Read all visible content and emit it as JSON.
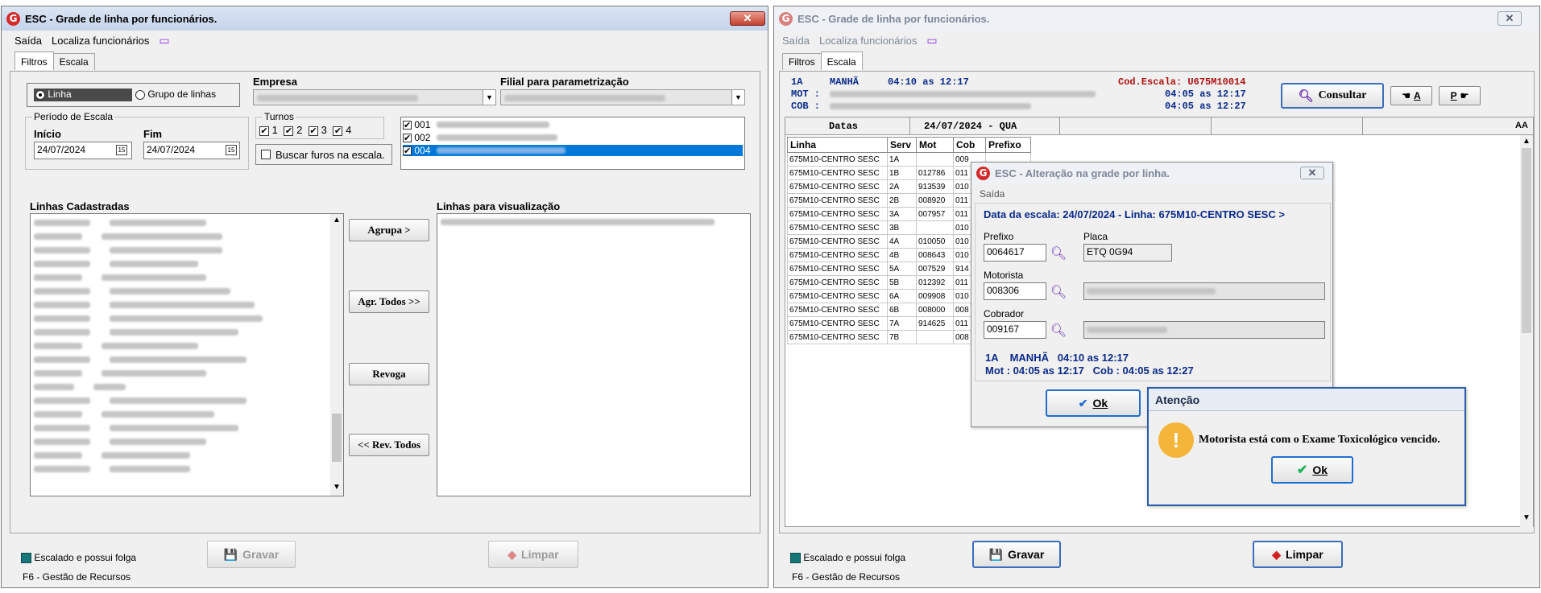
{
  "colors": {
    "title_active": "#c5d4ea",
    "close_red": "#c2402c",
    "accent_blue": "#0a2a8a",
    "status_red": "#b01010",
    "teal": "#17767a",
    "selection": "#0078d7"
  },
  "left": {
    "title": "ESC - Grade de linha por funcionários.",
    "close": "✕",
    "menu": {
      "saida": "Saída",
      "localiza": "Localiza funcionários"
    },
    "tabs": [
      "Filtros",
      "Escala"
    ],
    "radio_linha": "Linha",
    "radio_grupo": "Grupo de linhas",
    "empresa_label": "Empresa",
    "filial_label": "Filial para parametrização",
    "periodo_label": "Período de Escala",
    "inicio_label": "Início",
    "fim_label": "Fim",
    "inicio_value": "24/07/2024",
    "fim_value": "24/07/2024",
    "turnos_label": "Turnos",
    "turnos": [
      "1",
      "2",
      "3",
      "4"
    ],
    "buscar_label": "Buscar furos na escala.",
    "filiais": [
      "001",
      "002",
      "004"
    ],
    "linhas_cadastradas_label": "Linhas Cadastradas",
    "linhas_visualizacao_label": "Linhas para visualização",
    "btn_agrupa": "Agrupa >",
    "btn_agr_todos": "Agr. Todos >>",
    "btn_revoga": "Revoga",
    "btn_rev_todos": "<< Rev. Todos",
    "legend": "Escalado e possui folga",
    "f6": "F6 - Gestão de Recursos",
    "btn_gravar": "Gravar",
    "btn_limpar": "Limpar"
  },
  "right": {
    "title": "ESC - Grade de linha por funcionários.",
    "close": "✕",
    "menu": {
      "saida": "Saída",
      "localiza": "Localiza funcionários"
    },
    "tabs": [
      "Filtros",
      "Escala"
    ],
    "info_serv": "1A",
    "info_turno": "MANHÃ",
    "info_horario": "04:10 as 12:17",
    "info_codescala": "Cod.Escala: U675M10014",
    "mot_label": "MOT :",
    "cob_label": "COB :",
    "mot_horario": "04:05 as 12:17",
    "cob_horario": "04:05 as 12:27",
    "btn_consultar": "Consultar",
    "btn_a": "A",
    "btn_p": "P",
    "datas_label": "Datas",
    "date_header": "24/07/2024 - QUA",
    "aa_icon": "AA",
    "columns": [
      "Linha",
      "Serv",
      "Mot",
      "Cob",
      "Prefixo"
    ],
    "rows": [
      {
        "linha": "675M10-CENTRO SESC",
        "serv": "1A",
        "mot": "",
        "cob": "009"
      },
      {
        "linha": "675M10-CENTRO SESC",
        "serv": "1B",
        "mot": "012786",
        "cob": "011"
      },
      {
        "linha": "675M10-CENTRO SESC",
        "serv": "2A",
        "mot": "913539",
        "cob": "010"
      },
      {
        "linha": "675M10-CENTRO SESC",
        "serv": "2B",
        "mot": "008920",
        "cob": "011"
      },
      {
        "linha": "675M10-CENTRO SESC",
        "serv": "3A",
        "mot": "007957",
        "cob": "011"
      },
      {
        "linha": "675M10-CENTRO SESC",
        "serv": "3B",
        "mot": "",
        "cob": "010"
      },
      {
        "linha": "675M10-CENTRO SESC",
        "serv": "4A",
        "mot": "010050",
        "cob": "010"
      },
      {
        "linha": "675M10-CENTRO SESC",
        "serv": "4B",
        "mot": "008643",
        "cob": "010"
      },
      {
        "linha": "675M10-CENTRO SESC",
        "serv": "5A",
        "mot": "007529",
        "cob": "914"
      },
      {
        "linha": "675M10-CENTRO SESC",
        "serv": "5B",
        "mot": "012392",
        "cob": "011"
      },
      {
        "linha": "675M10-CENTRO SESC",
        "serv": "6A",
        "mot": "009908",
        "cob": "010"
      },
      {
        "linha": "675M10-CENTRO SESC",
        "serv": "6B",
        "mot": "008000",
        "cob": "008"
      },
      {
        "linha": "675M10-CENTRO SESC",
        "serv": "7A",
        "mot": "914625",
        "cob": "011"
      },
      {
        "linha": "675M10-CENTRO SESC",
        "serv": "7B",
        "mot": "",
        "cob": "008"
      }
    ],
    "legend": "Escalado e possui folga",
    "f6": "F6 - Gestão de Recursos",
    "btn_gravar": "Gravar",
    "btn_limpar": "Limpar"
  },
  "dialog": {
    "title": "ESC - Alteração na grade por linha.",
    "close": "✕",
    "menu_saida": "Saída",
    "header": "Data da escala: 24/07/2024 - Linha: 675M10-CENTRO SESC >",
    "prefixo_label": "Prefixo",
    "prefixo_value": "0064617",
    "placa_label": "Placa",
    "placa_value": "ETQ 0G94",
    "motorista_label": "Motorista",
    "motorista_value": "008306",
    "cobrador_label": "Cobrador",
    "cobrador_value": "009167",
    "line1": "1A    MANHÃ   04:10 as 12:17",
    "line2": "Mot : 04:05 as 12:17   Cob : 04:05 as 12:27",
    "ok": "Ok"
  },
  "alert": {
    "title": "Atenção",
    "icon": "!",
    "message": "Motorista está com o Exame Toxicológico vencido.",
    "ok": "Ok"
  }
}
